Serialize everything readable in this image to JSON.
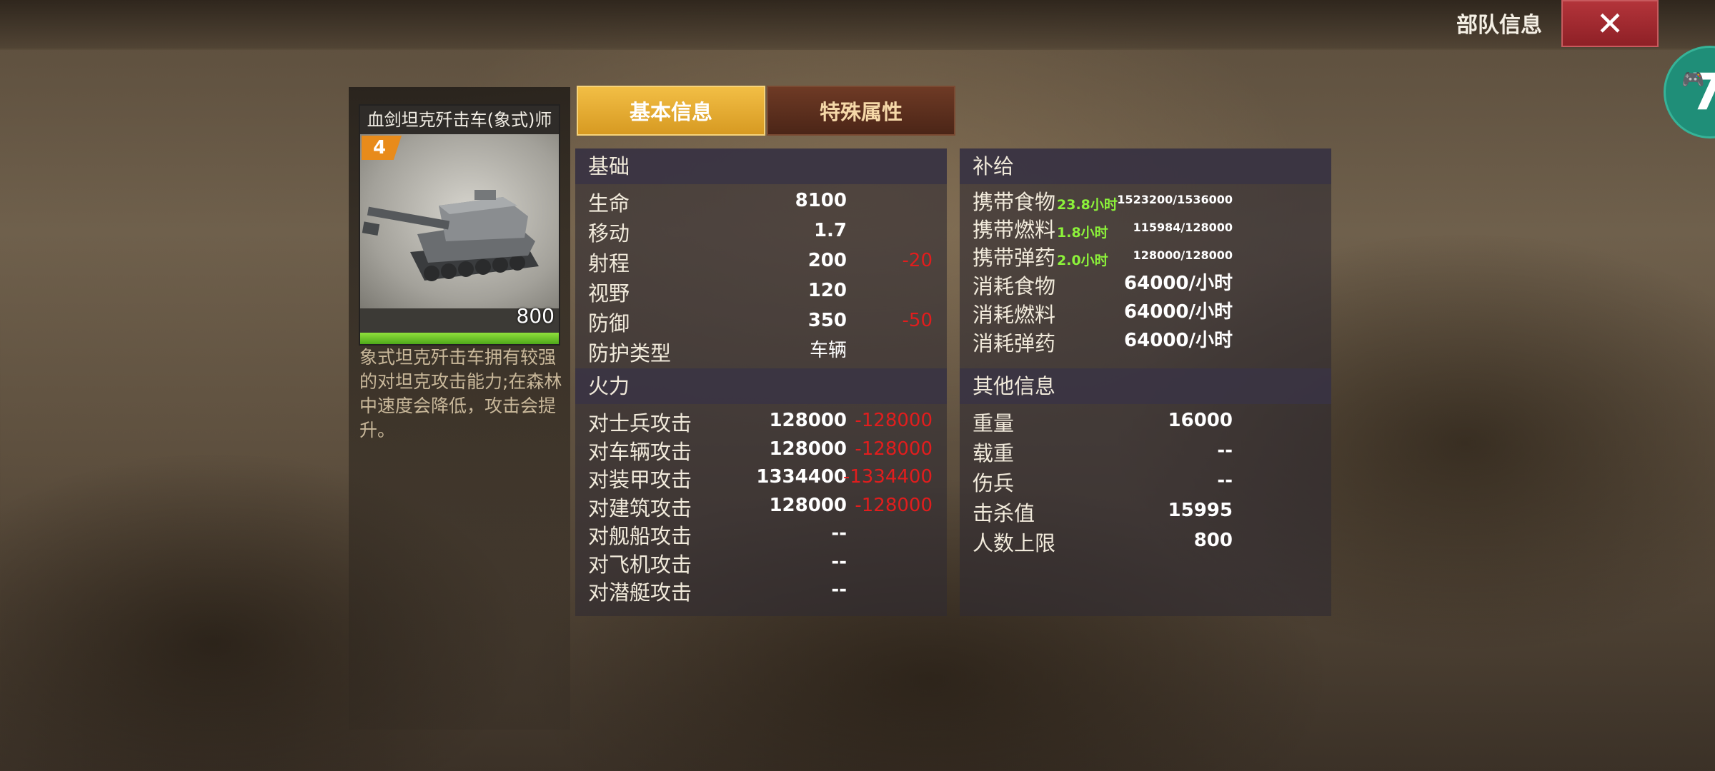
{
  "header": {
    "title": "部队信息",
    "close_label": "✕"
  },
  "side_badge": {
    "label": "7"
  },
  "unit": {
    "name": "血剑坦克歼击车(象式)师",
    "level": "4",
    "count": "800",
    "hp_fraction": 1.0,
    "description": "象式坦克歼击车拥有较强的对坦克攻击能力;在森林中速度会降低，攻击会提升。"
  },
  "tabs": [
    {
      "label": "基本信息",
      "active": true
    },
    {
      "label": "特殊属性",
      "active": false
    }
  ],
  "basic": {
    "header": "基础",
    "rows": [
      {
        "label": "生命",
        "value": "8100",
        "mod": ""
      },
      {
        "label": "移动",
        "value": "1.7",
        "mod": ""
      },
      {
        "label": "射程",
        "value": "200",
        "mod": "-20"
      },
      {
        "label": "视野",
        "value": "120",
        "mod": ""
      },
      {
        "label": "防御",
        "value": "350",
        "mod": "-50"
      },
      {
        "label": "防护类型",
        "value": "车辆",
        "mod": ""
      }
    ]
  },
  "firepower": {
    "header": "火力",
    "rows": [
      {
        "label": "对士兵攻击",
        "value": "128000",
        "mod": "-128000"
      },
      {
        "label": "对车辆攻击",
        "value": "128000",
        "mod": "-128000"
      },
      {
        "label": "对装甲攻击",
        "value": "1334400",
        "mod": "-1334400"
      },
      {
        "label": "对建筑攻击",
        "value": "128000",
        "mod": "-128000"
      },
      {
        "label": "对舰船攻击",
        "value": "--",
        "mod": ""
      },
      {
        "label": "对飞机攻击",
        "value": "--",
        "mod": ""
      },
      {
        "label": "对潜艇攻击",
        "value": "--",
        "mod": ""
      }
    ]
  },
  "supply": {
    "header": "补给",
    "carry": [
      {
        "label": "携带食物",
        "hours": "23.8小时",
        "amount": "1523200/1536000"
      },
      {
        "label": "携带燃料",
        "hours": "1.8小时",
        "amount": "115984/128000"
      },
      {
        "label": "携带弹药",
        "hours": "2.0小时",
        "amount": "128000/128000"
      }
    ],
    "consume": [
      {
        "label": "消耗食物",
        "value": "64000/小时"
      },
      {
        "label": "消耗燃料",
        "value": "64000/小时"
      },
      {
        "label": "消耗弹药",
        "value": "64000/小时"
      }
    ]
  },
  "other": {
    "header": "其他信息",
    "rows": [
      {
        "label": "重量",
        "value": "16000"
      },
      {
        "label": "载重",
        "value": "--"
      },
      {
        "label": "伤兵",
        "value": "--"
      },
      {
        "label": "击杀值",
        "value": "15995"
      },
      {
        "label": "人数上限",
        "value": "800"
      }
    ]
  }
}
